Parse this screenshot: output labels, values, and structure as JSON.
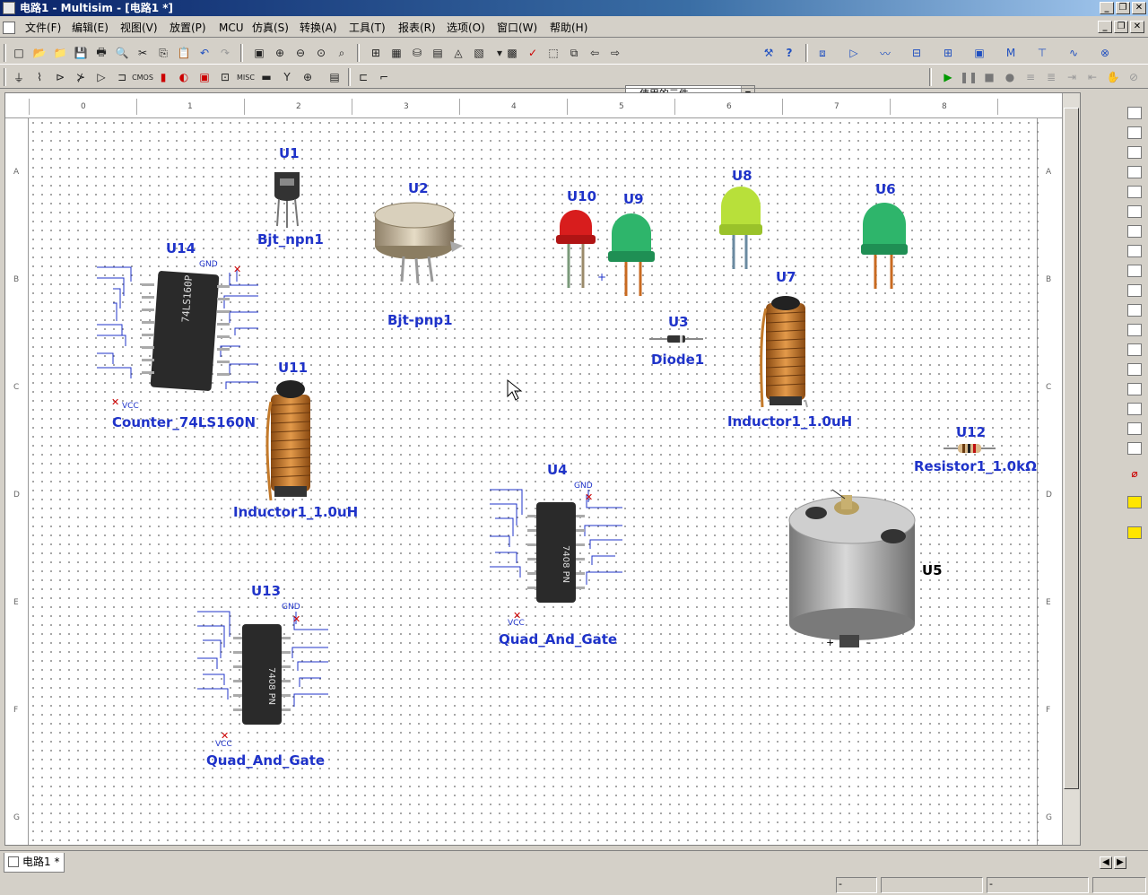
{
  "window": {
    "title": "电路1 - Multisim - [电路1 *]"
  },
  "menu": [
    "文件(F)",
    "编辑(E)",
    "视图(V)",
    "放置(P)",
    "MCU",
    "仿真(S)",
    "转换(A)",
    "工具(T)",
    "报表(R)",
    "选项(O)",
    "窗口(W)",
    "帮助(H)"
  ],
  "toolbar": {
    "component_combo": "---使用的元件---"
  },
  "ruler": {
    "columns": [
      "0",
      "1",
      "2",
      "3",
      "4",
      "5",
      "6",
      "7",
      "8"
    ],
    "rows": [
      "A",
      "B",
      "C",
      "D",
      "E",
      "F",
      "G"
    ]
  },
  "components": {
    "u1": {
      "ref": "U1",
      "name": "Bjt_npn1"
    },
    "u2": {
      "ref": "U2",
      "name": "Bjt-pnp1"
    },
    "u3": {
      "ref": "U3",
      "name": "Diode1"
    },
    "u4": {
      "ref": "U4",
      "name": "Quad_And_Gate",
      "gnd": "GND",
      "vcc": "VCC"
    },
    "u5": {
      "ref": "U5",
      "plus": "+",
      "minus": "-"
    },
    "u6": {
      "ref": "U6"
    },
    "u7": {
      "ref": "U7",
      "name": "Inductor1_1.0uH"
    },
    "u8": {
      "ref": "U8"
    },
    "u9": {
      "ref": "U9"
    },
    "u10": {
      "ref": "U10",
      "plus": "+"
    },
    "u11": {
      "ref": "U11",
      "name": "Inductor1_1.0uH"
    },
    "u12": {
      "ref": "U12",
      "name": "Resistor1_1.0kΩ"
    },
    "u13": {
      "ref": "U13",
      "name": "Quad_And_Gate",
      "gnd": "GND",
      "vcc": "VCC"
    },
    "u14": {
      "ref": "U14",
      "name": "Counter_74LS160N",
      "gnd": "GND",
      "vcc": "VCC"
    }
  },
  "tabs": [
    {
      "label": "电路1",
      "modified_mark": "*"
    }
  ],
  "status": {
    "field1": "-",
    "field2": "-"
  },
  "colors": {
    "label_blue": "#1f33c9",
    "title_dark": "#0a246a"
  }
}
